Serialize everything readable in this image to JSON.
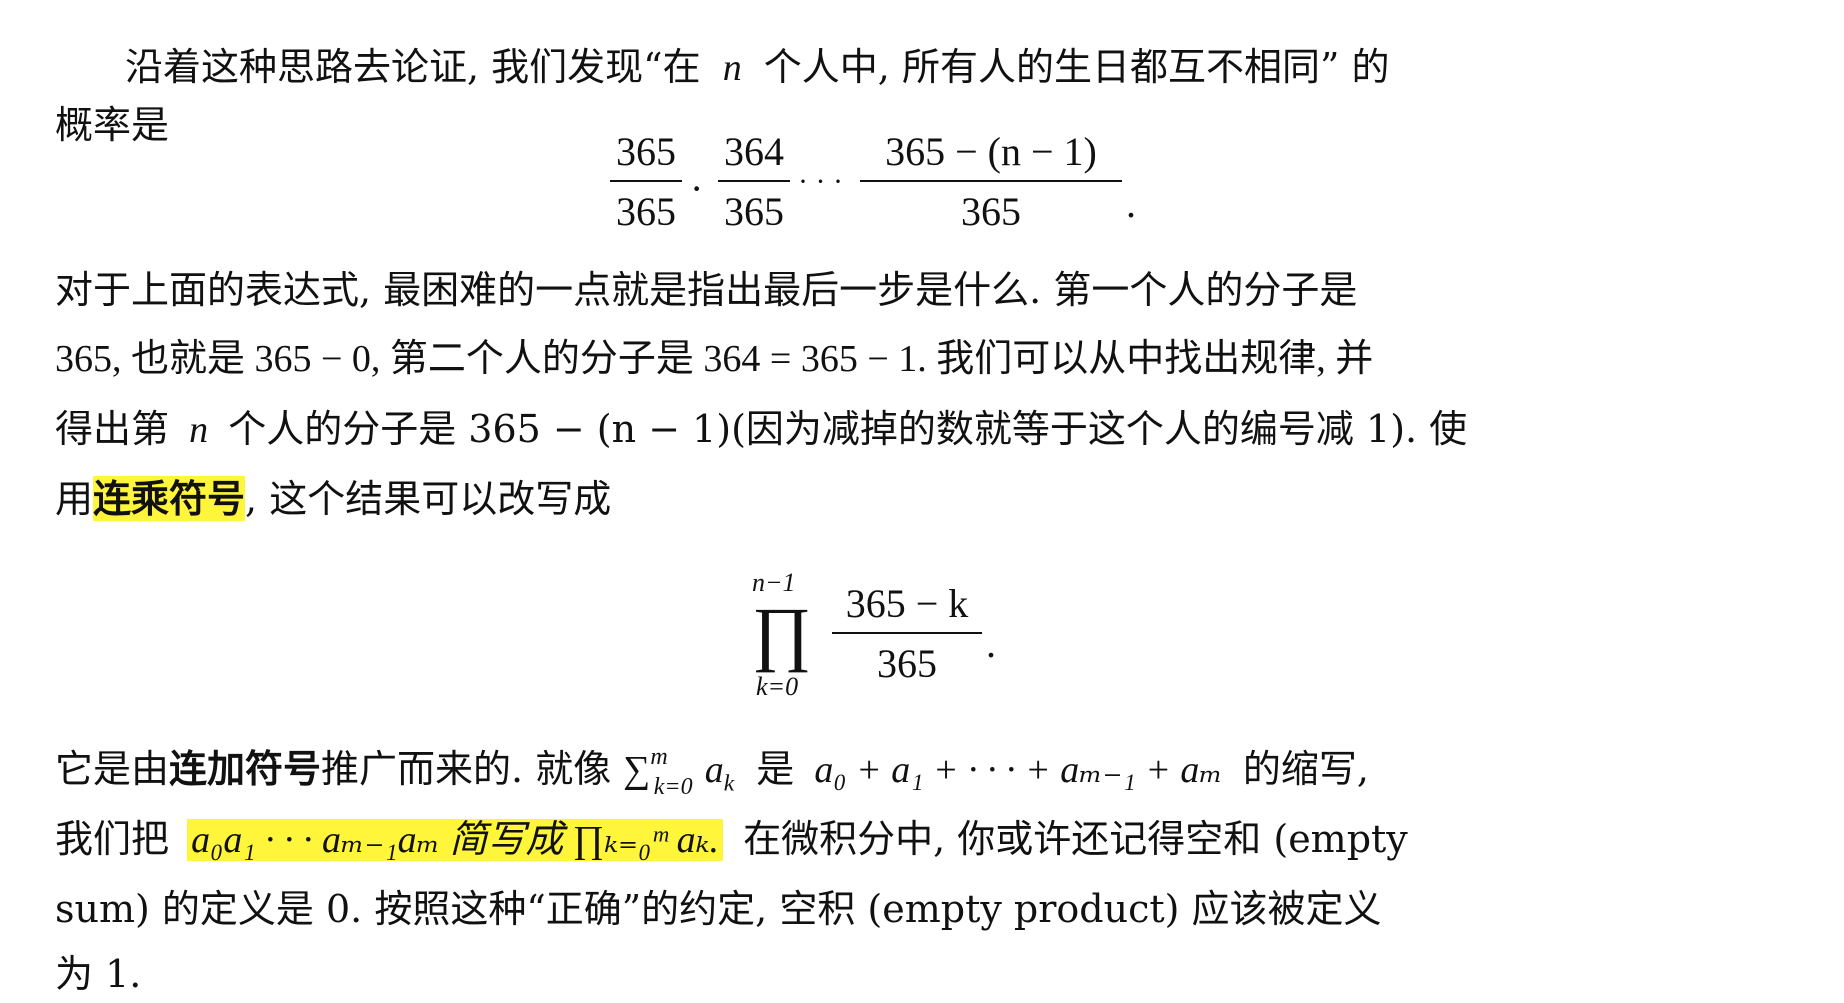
{
  "para1": {
    "line1": {
      "a": "沿着这种思路去论证, 我们发现“在",
      "n": "n",
      "b": "个人中, 所有人的生日都互不相同” 的"
    },
    "line2": "概率是"
  },
  "display1": {
    "f1_num": "365",
    "f1_den": "365",
    "dot": "·",
    "f2_num": "364",
    "f2_den": "365",
    "cdots": "· · ·",
    "f3_num": "365 − (n − 1)",
    "f3_den": "365",
    "period": "."
  },
  "para2": {
    "line1": "对于上面的表达式, 最困难的一点就是指出最后一步是什么.  第一个人的分子是",
    "line2": "365, 也就是 365 − 0, 第二个人的分子是 364 = 365 − 1. 我们可以从中找出规律, 并",
    "line3": {
      "a": "得出第",
      "n": "n",
      "b": "个人的分子是 365 − (n − 1)(因为减掉的数就等于这个人的编号减 1). 使"
    },
    "line4": {
      "a": "用",
      "hl": "连乘符号",
      "b": ", 这个结果可以改写成"
    }
  },
  "display2": {
    "upper": "n−1",
    "prod": "∏",
    "lower": "k=0",
    "num": "365 − k",
    "den": "365",
    "period": "."
  },
  "para3": {
    "line1": {
      "a": "它是由",
      "bold": "连加符号",
      "b": "推广而来的.  就像",
      "sum": "∑",
      "sum_sup": "m",
      "sum_sub": "k=0",
      "ak": "a",
      "ak_sub": "k",
      "c": "是",
      "expr": "a₀ + a₁ + · · · + aₘ₋₁ + aₘ",
      "d": "的缩写,"
    },
    "line2": {
      "a": "我们把",
      "hl": "a₀a₁ · · · aₘ₋₁aₘ  简写成  ∏ₖ₌₀ᵐ aₖ.",
      "b": "在微积分中, 你或许还记得空和 (empty"
    },
    "line3": "sum) 的定义是 0.  按照这种“正确”的约定, 空积 (empty product) 应该被定义",
    "line4": "为 1."
  }
}
